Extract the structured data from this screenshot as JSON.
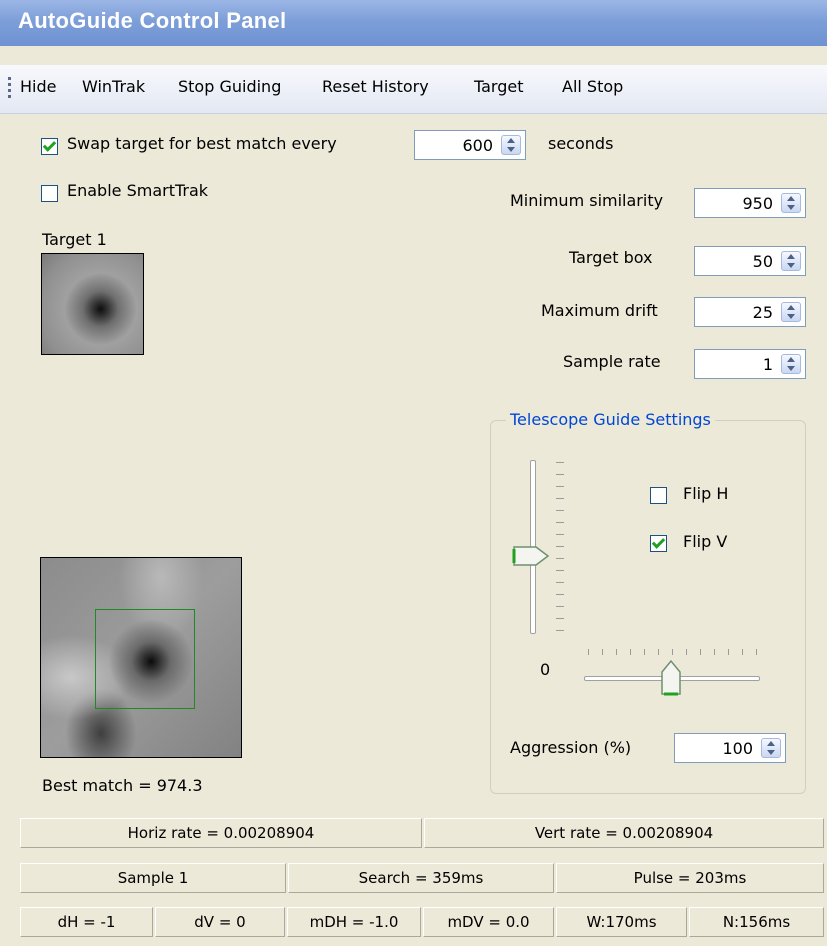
{
  "window": {
    "title": "AutoGuide Control Panel"
  },
  "menu": [
    "Hide",
    "WinTrak",
    "Stop Guiding",
    "Reset History",
    "Target",
    "All Stop"
  ],
  "swap": {
    "label": "Swap target for best match every",
    "checked": true,
    "value": "600",
    "unit": "seconds"
  },
  "smarttrak": {
    "label": "Enable SmartTrak",
    "checked": false
  },
  "target": {
    "label": "Target 1"
  },
  "settings": {
    "min_similarity": {
      "label": "Minimum similarity",
      "value": "950"
    },
    "target_box": {
      "label": "Target box",
      "value": "50"
    },
    "max_drift": {
      "label": "Maximum drift",
      "value": "25"
    },
    "sample_rate": {
      "label": "Sample rate",
      "value": "1"
    }
  },
  "telescope": {
    "title": "Telescope Guide Settings",
    "flip_h": {
      "label": "Flip H",
      "checked": false
    },
    "flip_v": {
      "label": "Flip V",
      "checked": true
    },
    "h_slider_label": "0",
    "v_slider_level": 0.56,
    "h_slider_level": 0.5,
    "aggression": {
      "label": "Aggression (%)",
      "value": "100"
    }
  },
  "best_match": {
    "label": "Best match = 974.3"
  },
  "status": {
    "row1": [
      "Horiz rate = 0.00208904",
      "Vert rate = 0.00208904"
    ],
    "row2": [
      "Sample 1",
      "Search = 359ms",
      "Pulse = 203ms"
    ],
    "row3": [
      "dH = -1",
      "dV = 0",
      "mDH = -1.0",
      "mDV = 0.0",
      "W:170ms",
      "N:156ms"
    ]
  },
  "colors": {
    "title_bar": "#7d9ed8",
    "accent_check": "#21a121",
    "group_title": "#0046d5",
    "match_box": "#1f8a1f"
  }
}
